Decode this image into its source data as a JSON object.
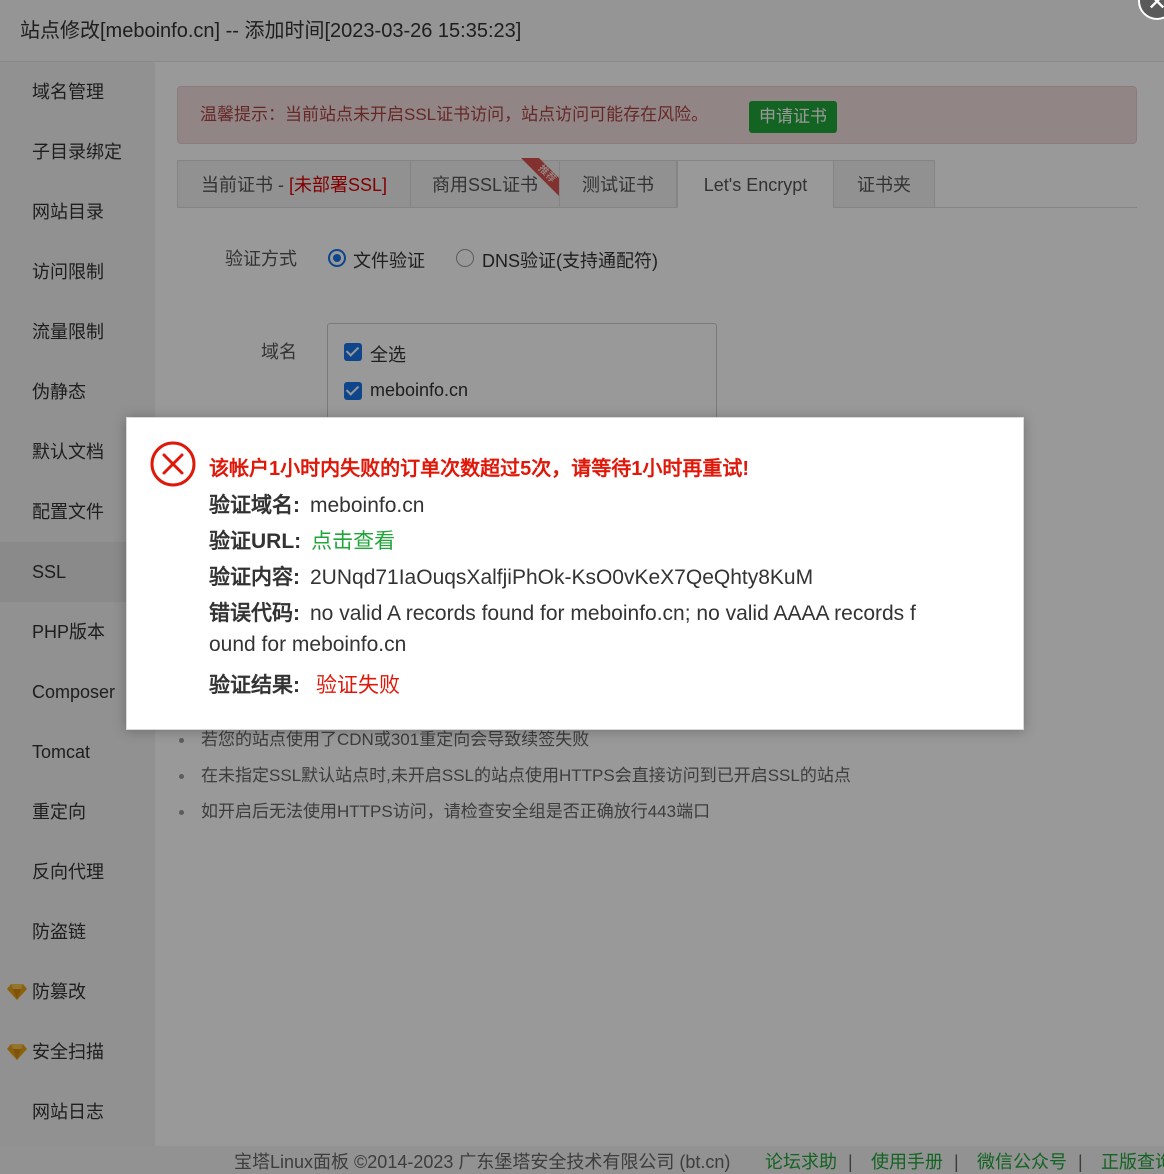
{
  "window": {
    "title": "站点修改[meboinfo.cn] -- 添加时间[2023-03-26 15:35:23]",
    "close_glyph": "✕"
  },
  "sidebar": {
    "items": [
      {
        "label": "域名管理"
      },
      {
        "label": "子目录绑定"
      },
      {
        "label": "网站目录"
      },
      {
        "label": "访问限制"
      },
      {
        "label": "流量限制"
      },
      {
        "label": "伪静态"
      },
      {
        "label": "默认文档"
      },
      {
        "label": "配置文件"
      },
      {
        "label": "SSL",
        "active": true
      },
      {
        "label": "PHP版本"
      },
      {
        "label": "Composer"
      },
      {
        "label": "Tomcat"
      },
      {
        "label": "重定向"
      },
      {
        "label": "反向代理"
      },
      {
        "label": "防盗链"
      },
      {
        "label": "防篡改",
        "icon": "diamond-icon"
      },
      {
        "label": "安全扫描",
        "icon": "diamond-icon"
      },
      {
        "label": "网站日志"
      }
    ]
  },
  "warning": {
    "text": "温馨提示：当前站点未开启SSL证书访问，站点访问可能存在风险。",
    "button": "申请证书"
  },
  "tabs": {
    "current_cert": "当前证书 - ",
    "current_cert_status": "[未部署SSL]",
    "commercial": "商用SSL证书",
    "ribbon": "推荐",
    "test": "测试证书",
    "letsencrypt": "Let's Encrypt",
    "folder": "证书夹"
  },
  "form": {
    "verify_label": "验证方式",
    "file_verify": "文件验证",
    "dns_verify": "DNS验证(支持通配符)",
    "domain_label": "域名",
    "select_all": "全选",
    "domain": "meboinfo.cn"
  },
  "tips": {
    "partial": "若您的站点使用了CDN或301重定向会导致续签失败",
    "items": [
      "在未指定SSL默认站点时,未开启SSL的站点使用HTTPS会直接访问到已开启SSL的站点",
      "如开启后无法使用HTTPS访问，请检查安全组是否正确放行443端口"
    ]
  },
  "dialog": {
    "title": "该帐户1小时内失败的订单次数超过5次，请等待1小时再重试!",
    "domain_key": "验证域名:",
    "domain_val": "meboinfo.cn",
    "url_key": "验证URL:",
    "url_val": "点击查看",
    "content_key": "验证内容:",
    "content_val": "2UNqd71IaOuqsXalfjiPhOk-KsO0vKeX7QeQhty8KuM",
    "error_key": "错误代码:",
    "error_val_line1": "no valid A records found for meboinfo.cn; no valid AAAA records f",
    "error_val_line2": "ound for meboinfo.cn",
    "result_key": "验证结果:",
    "result_val": "验证失败"
  },
  "footer": {
    "copyright": "宝塔Linux面板 ©2014-2023 广东堡塔安全技术有限公司 (bt.cn)",
    "links": [
      "论坛求助",
      "使用手册",
      "微信公众号",
      "正版查询"
    ],
    "separator": "|"
  },
  "colors": {
    "accent_green": "#20a53a",
    "error_red": "#e0180a",
    "warn_bg": "#f2dede",
    "radio_blue": "#1a73e8"
  }
}
